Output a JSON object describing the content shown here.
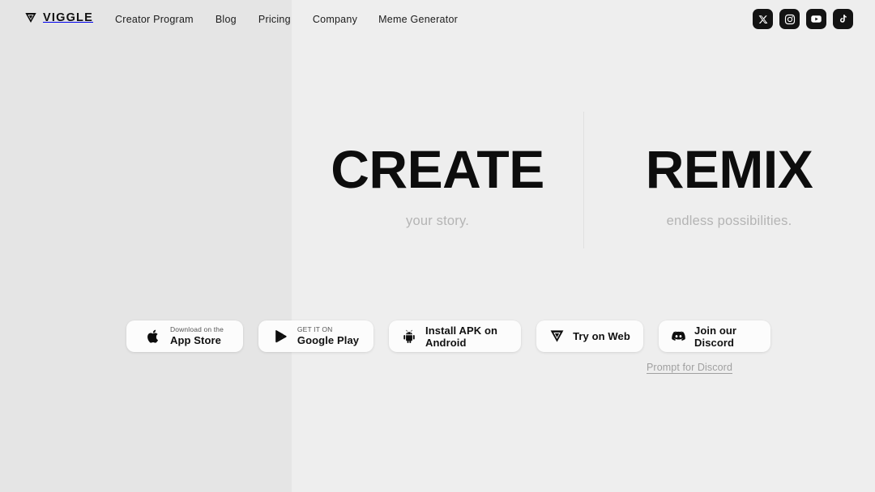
{
  "brand": {
    "name": "VIGGLE",
    "logo_icon": "viggle-triangle-icon",
    "accent_dark": "#131313",
    "background_left": "#e5e5e5",
    "background_right": "#eeeeee"
  },
  "nav": {
    "items": [
      {
        "label": "Creator Program",
        "name": "nav-creator-program"
      },
      {
        "label": "Blog",
        "name": "nav-blog"
      },
      {
        "label": "Pricing",
        "name": "nav-pricing"
      },
      {
        "label": "Company",
        "name": "nav-company"
      },
      {
        "label": "Meme Generator",
        "name": "nav-meme-generator"
      }
    ]
  },
  "socials": [
    {
      "icon": "x-twitter-icon",
      "label": "X"
    },
    {
      "icon": "instagram-icon",
      "label": "Instagram"
    },
    {
      "icon": "youtube-icon",
      "label": "YouTube"
    },
    {
      "icon": "tiktok-icon",
      "label": "TikTok"
    }
  ],
  "hero": {
    "left": {
      "title": "CREATE",
      "subtitle": "your story."
    },
    "right": {
      "title": "REMIX",
      "subtitle": "endless possibilities."
    }
  },
  "cta": {
    "app_store": {
      "small": "Download on the",
      "big": "App Store",
      "icon": "apple-icon"
    },
    "google_play": {
      "small": "GET IT ON",
      "big": "Google Play",
      "icon": "google-play-icon"
    },
    "apk": {
      "label": "Install APK on Android",
      "icon": "android-icon"
    },
    "web": {
      "label": "Try on Web",
      "icon": "viggle-triangle-icon"
    },
    "discord": {
      "label": "Join our Discord",
      "icon": "discord-icon"
    }
  },
  "prompt_link": {
    "label": "Prompt for Discord"
  }
}
